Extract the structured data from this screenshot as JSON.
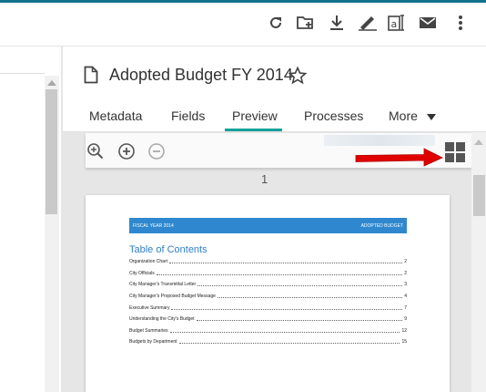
{
  "colors": {
    "accent": "#12728a",
    "tab_active": "#12a29a",
    "arrow": "#e00000",
    "page_header": "#2f88cf",
    "toc_title": "#2f7fc7"
  },
  "toolbar": {
    "icons": [
      "refresh-icon",
      "new-folder-icon",
      "download-icon",
      "sign-icon",
      "text-icon",
      "mail-icon",
      "more-vert-icon"
    ]
  },
  "document": {
    "title": "Adopted Budget FY 2014",
    "icon": "file-icon",
    "favorite_icon": "star-icon"
  },
  "tabs": [
    {
      "label": "Metadata",
      "active": false
    },
    {
      "label": "Fields",
      "active": false
    },
    {
      "label": "Preview",
      "active": true
    },
    {
      "label": "Processes",
      "active": false
    },
    {
      "label": "More",
      "active": false,
      "icon": "caret-down-icon"
    }
  ],
  "viewer": {
    "zoom_icons": [
      "zoom-in-icon",
      "plus-circle-icon",
      "minus-circle-icon"
    ],
    "grid_icon": "grid-view-icon",
    "page_number": "1",
    "page": {
      "header_left": "FISCAL YEAR 2014",
      "header_right": "ADOPTED BUDGET",
      "toc_title": "Table of Contents",
      "toc": [
        {
          "label": "Organization Chart",
          "page": "2"
        },
        {
          "label": "City Officials",
          "page": "2"
        },
        {
          "label": "City Manager's Transmittal Letter",
          "page": "3"
        },
        {
          "label": "City Manager's Proposed Budget Message",
          "page": "4"
        },
        {
          "label": "Executive Summary",
          "page": "7"
        },
        {
          "label": "Understanding the City's Budget",
          "page": "9"
        },
        {
          "label": "Budget Summaries",
          "page": "12"
        },
        {
          "label": "Budgets by Department",
          "page": "15"
        }
      ]
    }
  }
}
